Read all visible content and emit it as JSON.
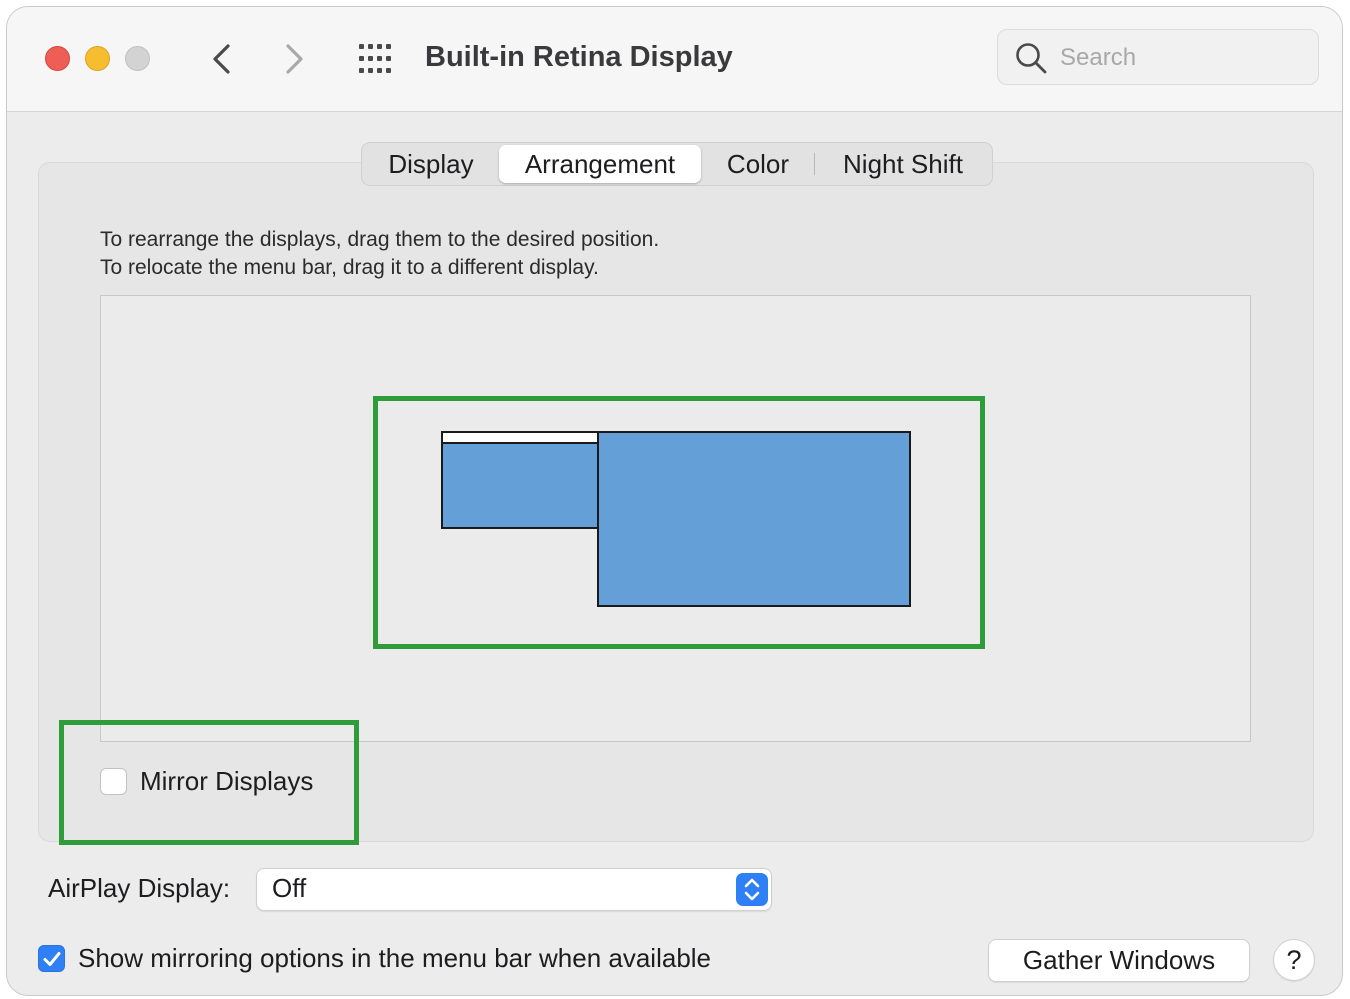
{
  "window": {
    "title": "Built-in Retina Display"
  },
  "toolbar": {
    "back_icon": "chevron-left-icon",
    "forward_icon": "chevron-right-icon",
    "show_all_icon": "grid-icon"
  },
  "search": {
    "placeholder": "Search",
    "icon": "search-icon"
  },
  "tabs": [
    {
      "label": "Display",
      "active": false
    },
    {
      "label": "Arrangement",
      "active": true
    },
    {
      "label": "Color",
      "active": false
    },
    {
      "label": "Night Shift",
      "active": false
    }
  ],
  "instructions": {
    "line1": "To rearrange the displays, drag them to the desired position.",
    "line2": "To relocate the menu bar, drag it to a different display."
  },
  "arrangement": {
    "display_color": "#649fd7",
    "highlight_color": "#2e9c3b"
  },
  "mirror": {
    "label": "Mirror Displays",
    "checked": false
  },
  "airplay": {
    "label": "AirPlay Display:",
    "value": "Off"
  },
  "show_mirroring": {
    "label": "Show mirroring options in the menu bar when available",
    "checked": true
  },
  "buttons": {
    "gather_windows": "Gather Windows",
    "help": "?"
  },
  "colors": {
    "accent": "#2f7ff7",
    "close": "#ee5d56",
    "minimize": "#f5bd2f",
    "zoom_disabled": "#d3d3d3"
  }
}
